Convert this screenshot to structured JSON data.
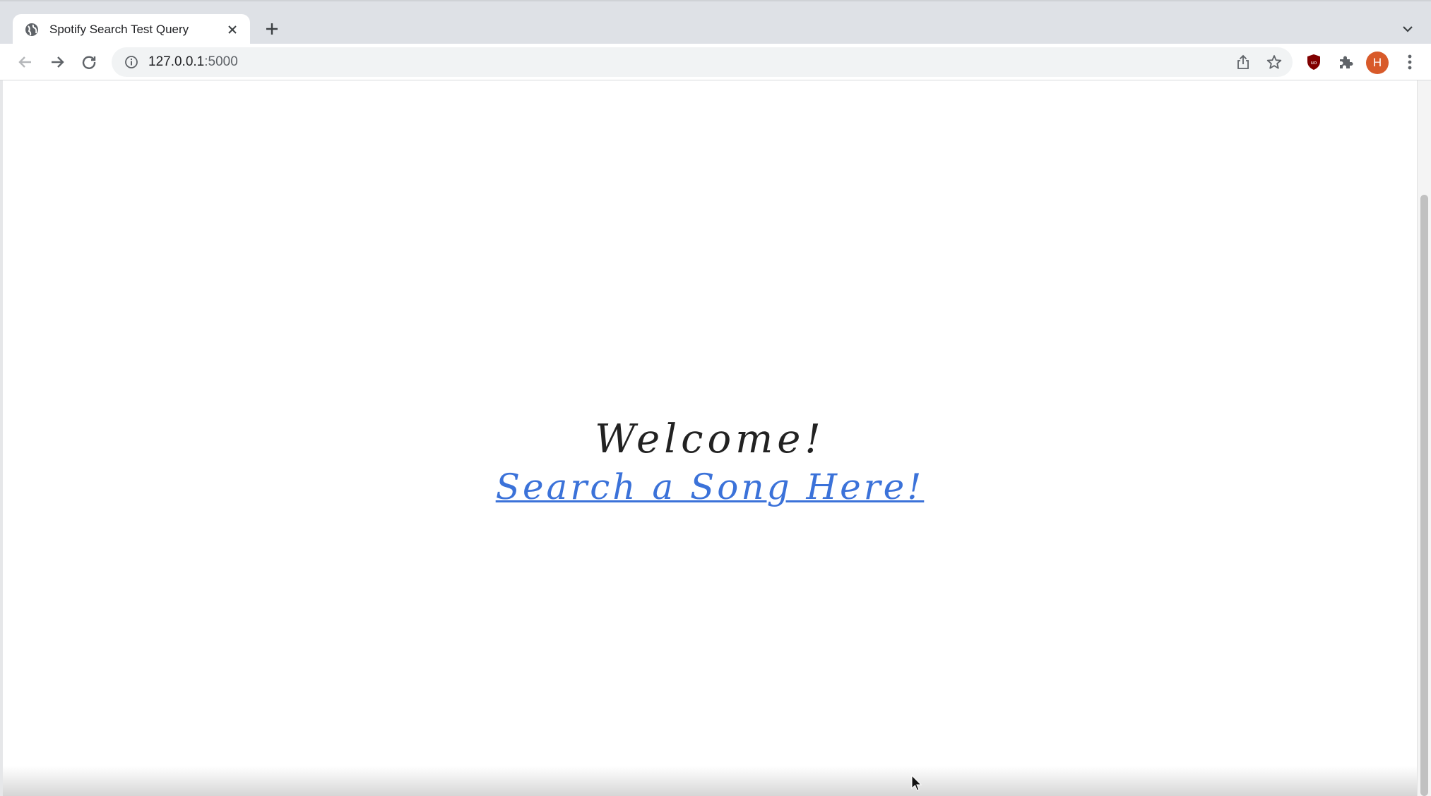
{
  "browser": {
    "tab": {
      "title": "Spotify Search Test Query"
    },
    "address_bar": {
      "host": "127.0.0.1",
      "port_suffix": ":5000"
    },
    "profile_initial": "H"
  },
  "page": {
    "heading": "Welcome!",
    "link_text": "Search a Song Here!"
  },
  "colors": {
    "link": "#3b72d9",
    "heading": "#222222",
    "avatar": "#d85a2a"
  }
}
